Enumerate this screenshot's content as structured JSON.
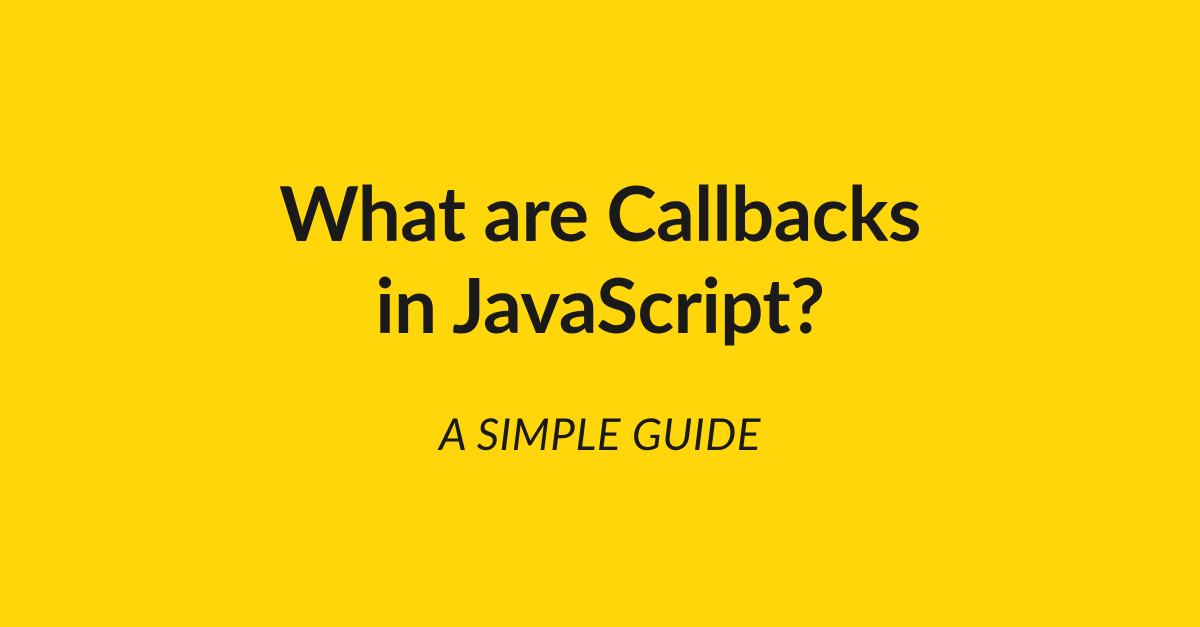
{
  "title_line1": "What are Callbacks",
  "title_line2": "in JavaScript?",
  "subtitle": "A SIMPLE GUIDE",
  "colors": {
    "background": "#FFD60A",
    "text": "#1a1a1a"
  }
}
